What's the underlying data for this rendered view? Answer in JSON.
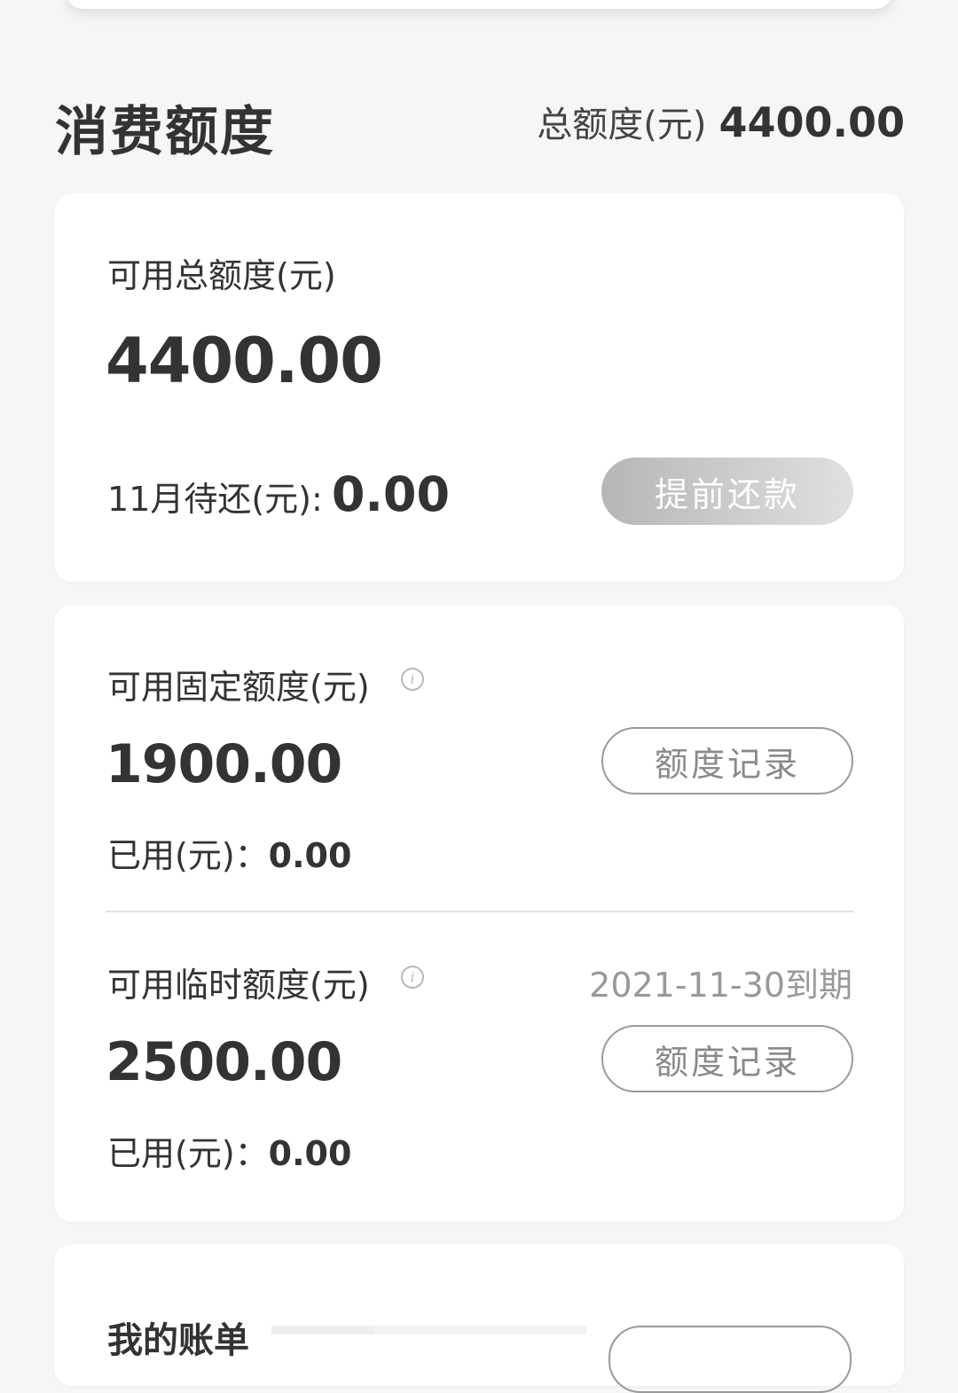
{
  "header": {
    "title": "消费额度",
    "total_label": "总额度(元)",
    "total_value": "4400.00"
  },
  "available_card": {
    "label": "可用总额度(元)",
    "amount": "4400.00",
    "due_label": "11月待还(元):",
    "due_value": "0.00",
    "prepay_button": "提前还款"
  },
  "fixed_quota": {
    "label": "可用固定额度(元)",
    "info_icon": "info-icon",
    "amount": "1900.00",
    "record_button": "额度记录",
    "used_label": "已用(元)：",
    "used_value": "0.00"
  },
  "temp_quota": {
    "label": "可用临时额度(元)",
    "info_icon": "info-icon",
    "expiry": "2021-11-30到期",
    "amount": "2500.00",
    "record_button": "额度记录",
    "used_label": "已用(元)：",
    "used_value": "0.00"
  },
  "bills_card": {
    "title": "我的账单"
  },
  "colors": {
    "background": "#f6f6f6",
    "card": "#ffffff",
    "text_primary": "#333333",
    "text_muted": "#999999",
    "button_outline": "#9a9a9a"
  }
}
